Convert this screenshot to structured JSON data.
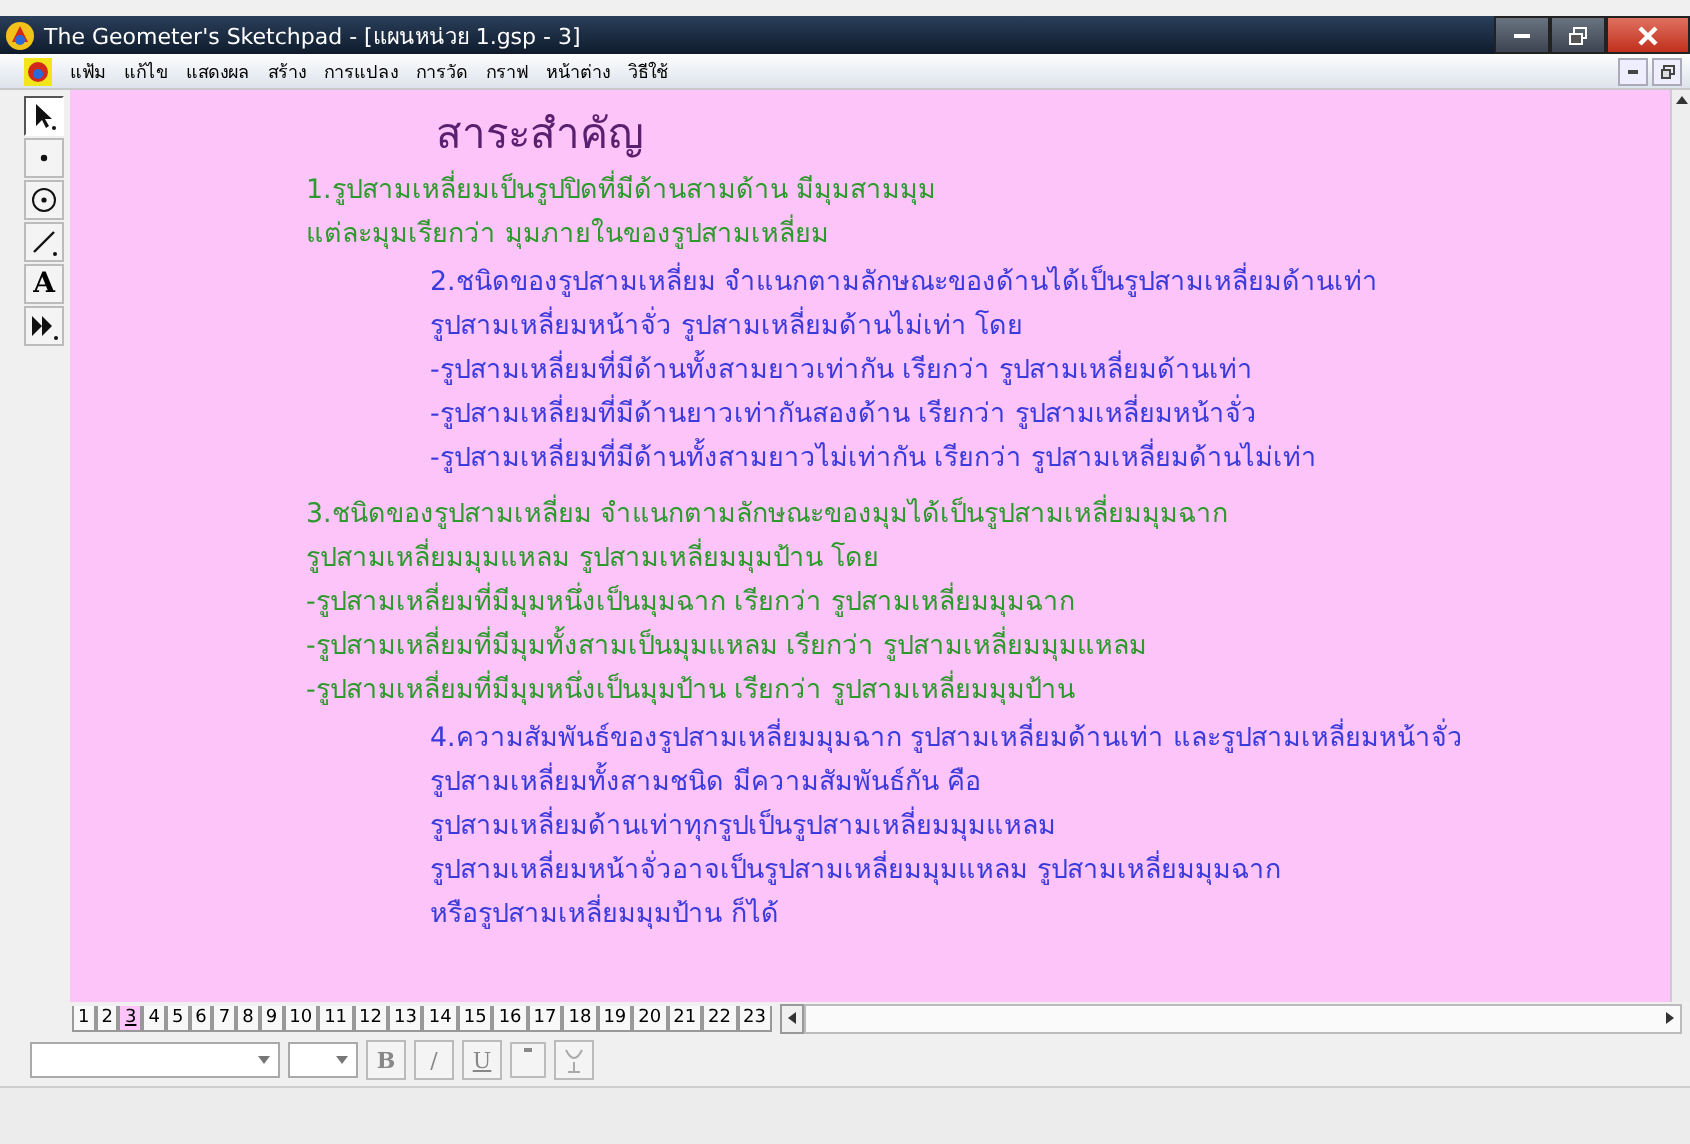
{
  "window": {
    "title": "The Geometer's Sketchpad - [แผนหน่วย 1.gsp - 3]"
  },
  "menu": [
    "แฟ้ม",
    "แก้ไข",
    "แสดงผล",
    "สร้าง",
    "การแปลง",
    "การวัด",
    "กราฟ",
    "หน้าต่าง",
    "วิธีใช้"
  ],
  "tools": [
    {
      "kind": "arrow",
      "selected": true
    },
    {
      "kind": "point",
      "selected": false
    },
    {
      "kind": "compass",
      "selected": false
    },
    {
      "kind": "line",
      "selected": false
    },
    {
      "kind": "text",
      "label": "A",
      "selected": false
    },
    {
      "kind": "custom",
      "selected": false
    }
  ],
  "document": {
    "title": "สาระสำคัญ",
    "paragraphs": [
      {
        "kind": "main",
        "color": "#2e9a2e",
        "lines": [
          "1.รูปสามเหลี่ยมเป็นรูปปิดที่มีด้านสามด้าน  มีมุมสามมุม",
          "แต่ละมุมเรียกว่า มุมภายในของรูปสามเหลี่ยม"
        ]
      },
      {
        "kind": "sub",
        "color": "#3b3bdc",
        "lines": [
          "2.ชนิดของรูปสามเหลี่ยม จำแนกตามลักษณะของด้านได้เป็นรูปสามเหลี่ยมด้านเท่า",
          "รูปสามเหลี่ยมหน้าจั่ว รูปสามเหลี่ยมด้านไม่เท่า โดย",
          "-รูปสามเหลี่ยมที่มีด้านทั้งสามยาวเท่ากัน เรียกว่า รูปสามเหลี่ยมด้านเท่า",
          "-รูปสามเหลี่ยมที่มีด้านยาวเท่ากันสองด้าน เรียกว่า รูปสามเหลี่ยมหน้าจั่ว",
          "-รูปสามเหลี่ยมที่มีด้านทั้งสามยาวไม่เท่ากัน เรียกว่า รูปสามเหลี่ยมด้านไม่เท่า"
        ]
      },
      {
        "kind": "main",
        "color": "#2e9a2e",
        "lines": [
          "3.ชนิดของรูปสามเหลี่ยม จำแนกตามลักษณะของมุมได้เป็นรูปสามเหลี่ยมมุมฉาก",
          "รูปสามเหลี่ยมมุมแหลม รูปสามเหลี่ยมมุมป้าน โดย",
          "-รูปสามเหลี่ยมที่มีมุมหนึ่งเป็นมุมฉาก เรียกว่า รูปสามเหลี่ยมมุมฉาก",
          "-รูปสามเหลี่ยมที่มีมุมทั้งสามเป็นมุมแหลม เรียกว่า รูปสามเหลี่ยมมุมแหลม",
          "-รูปสามเหลี่ยมที่มีมุมหนึ่งเป็นมุมป้าน เรียกว่า รูปสามเหลี่ยมมุมป้าน"
        ]
      },
      {
        "kind": "sub",
        "color": "#3b3bdc",
        "lines": [
          "4.ความสัมพันธ์ของรูปสามเหลี่ยมมุมฉาก  รูปสามเหลี่ยมด้านเท่า และรูปสามเหลี่ยมหน้าจั่ว",
          "รูปสามเหลี่ยมทั้งสามชนิด มีความสัมพันธ์กัน คือ",
          "รูปสามเหลี่ยมด้านเท่าทุกรูปเป็นรูปสามเหลี่ยมมุมแหลม",
          "รูปสามเหลี่ยมหน้าจั่วอาจเป็นรูปสามเหลี่ยมมุมแหลม รูปสามเหลี่ยมมุมฉาก",
          "หรือรูปสามเหลี่ยมมุมป้าน ก็ได้"
        ]
      }
    ]
  },
  "page_tabs": [
    {
      "label": "1",
      "selected": false
    },
    {
      "label": "2",
      "selected": false
    },
    {
      "label": "3",
      "selected": true
    },
    {
      "label": "4",
      "selected": false
    },
    {
      "label": "5",
      "selected": false
    },
    {
      "label": "6",
      "selected": false
    },
    {
      "label": "7",
      "selected": false
    },
    {
      "label": "8",
      "selected": false
    },
    {
      "label": "9",
      "selected": false
    },
    {
      "label": "10",
      "selected": false
    },
    {
      "label": "11",
      "selected": false
    },
    {
      "label": "12",
      "selected": false
    },
    {
      "label": "13",
      "selected": false
    },
    {
      "label": "14",
      "selected": false
    },
    {
      "label": "15",
      "selected": false
    },
    {
      "label": "16",
      "selected": false
    },
    {
      "label": "17",
      "selected": false
    },
    {
      "label": "18",
      "selected": false
    },
    {
      "label": "19",
      "selected": false
    },
    {
      "label": "20",
      "selected": false
    },
    {
      "label": "21",
      "selected": false
    },
    {
      "label": "22",
      "selected": false
    },
    {
      "label": "23",
      "selected": false
    }
  ],
  "text_toolbar": {
    "buttons": [
      {
        "kind": "bold",
        "label": "B"
      },
      {
        "kind": "italic",
        "label": "/"
      },
      {
        "kind": "underline",
        "label": "U"
      }
    ]
  }
}
